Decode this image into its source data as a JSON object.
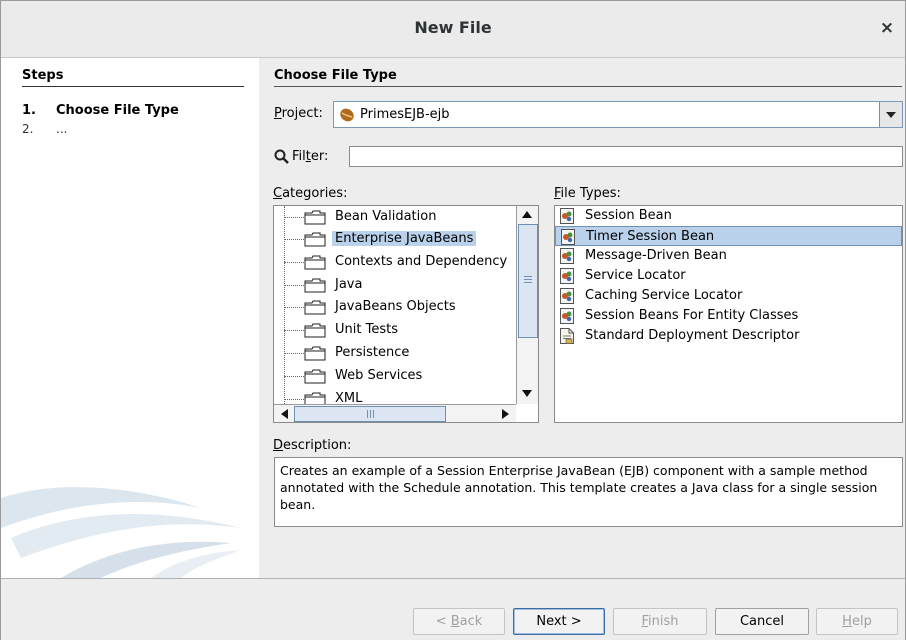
{
  "window": {
    "title": "New File",
    "close_glyph": "×"
  },
  "steps": {
    "header": "Steps",
    "items": [
      {
        "num": "1.",
        "label": "Choose File Type"
      },
      {
        "num": "2.",
        "label": "..."
      }
    ]
  },
  "main": {
    "header": "Choose File Type",
    "project": {
      "label_prefix": "",
      "label_accel": "P",
      "label_rest": "roject:",
      "value": "PrimesEJB-ejb",
      "icon": "bean-project-icon"
    },
    "filter": {
      "label_prefix": "Fil",
      "label_accel": "t",
      "label_rest": "er:",
      "value": ""
    },
    "categories": {
      "label_accel": "C",
      "label_rest": "ategories:",
      "items": [
        "Bean Validation",
        "Enterprise JavaBeans",
        "Contexts and Dependency",
        "Java",
        "JavaBeans Objects",
        "Unit Tests",
        "Persistence",
        "Web Services",
        "XML"
      ],
      "selected": "Enterprise JavaBeans"
    },
    "file_types": {
      "label_accel": "F",
      "label_rest": "ile Types:",
      "items": [
        "Session Bean",
        "Timer Session Bean",
        "Message-Driven Bean",
        "Service Locator",
        "Caching Service Locator",
        "Session Beans For Entity Classes",
        "Standard Deployment Descriptor"
      ],
      "selected": "Timer Session Bean"
    },
    "description": {
      "label_accel": "D",
      "label_rest": "escription:",
      "text": "Creates an example of a Session Enterprise JavaBean (EJB) component with a sample method annotated with the Schedule annotation. This template creates a Java class for a single session bean."
    }
  },
  "buttons": {
    "back": {
      "prefix": "< ",
      "accel": "B",
      "rest": "ack"
    },
    "next": {
      "label": "Next >"
    },
    "finish": {
      "accel": "F",
      "rest": "inish"
    },
    "cancel": {
      "label": "Cancel"
    },
    "help": {
      "accel": "H",
      "rest": "elp"
    }
  },
  "colors": {
    "selection": "#b9d1ea",
    "accent": "#3b6ea5"
  }
}
